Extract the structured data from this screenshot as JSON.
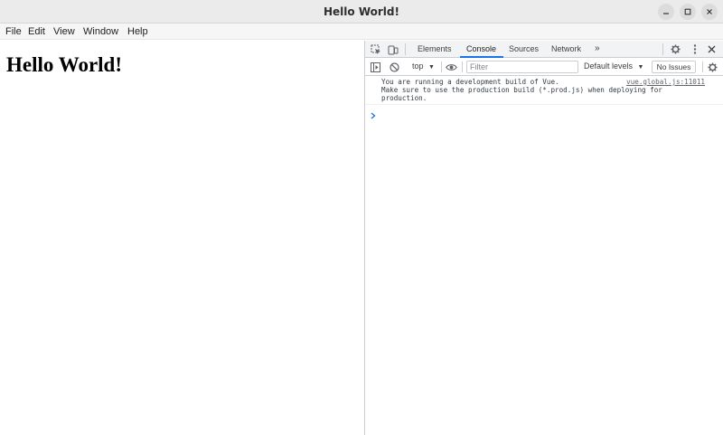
{
  "window": {
    "title": "Hello World!",
    "controls": [
      "minimize-icon",
      "maximize-icon",
      "close-icon"
    ]
  },
  "menu": {
    "items": [
      "File",
      "Edit",
      "View",
      "Window",
      "Help"
    ]
  },
  "page": {
    "heading": "Hello World!"
  },
  "devtools": {
    "tabs": [
      "Elements",
      "Console",
      "Sources",
      "Network"
    ],
    "active_tab": "Console",
    "more_tabs": "»",
    "toolbar": {
      "context": "top",
      "filter_placeholder": "Filter",
      "levels": "Default levels",
      "issues": "No Issues"
    },
    "console": {
      "messages": [
        {
          "text": "You are running a development build of Vue.\nMake sure to use the production build (*.prod.js) when deploying for\nproduction.",
          "source": "vue.global.js:11011"
        }
      ]
    },
    "colors": {
      "accent": "#1a73e8",
      "panel_bg": "#f1f3f4",
      "border": "#cbcdd1"
    }
  }
}
